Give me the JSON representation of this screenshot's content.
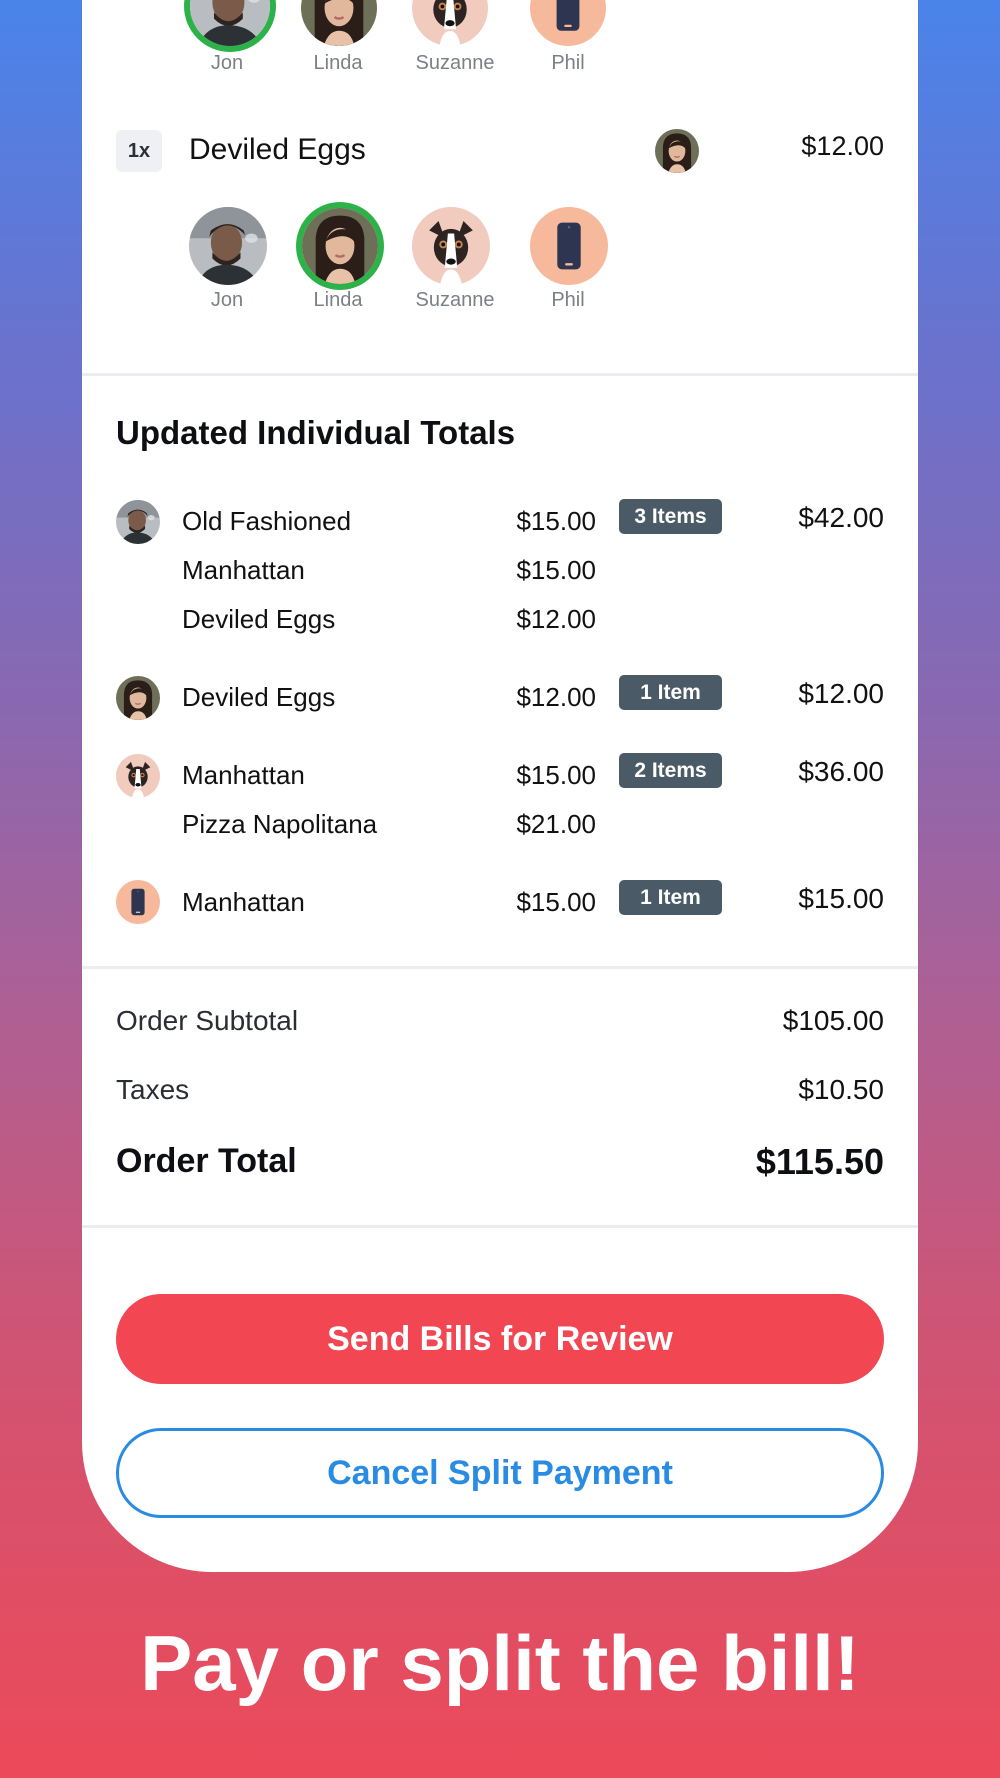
{
  "people": {
    "jon": "Jon",
    "linda": "Linda",
    "suzanne": "Suzanne",
    "phil": "Phil"
  },
  "item": {
    "qty": "1x",
    "name": "Deviled Eggs",
    "price": "$12.00"
  },
  "totals_section": {
    "title": "Updated Individual Totals",
    "groups": [
      {
        "items": [
          {
            "name": "Old Fashioned",
            "price": "$15.00"
          },
          {
            "name": "Manhattan",
            "price": "$15.00"
          },
          {
            "name": "Deviled Eggs",
            "price": "$12.00"
          }
        ],
        "badge": "3 Items",
        "total": "$42.00"
      },
      {
        "items": [
          {
            "name": "Deviled Eggs",
            "price": "$12.00"
          }
        ],
        "badge": "1 Item",
        "total": "$12.00"
      },
      {
        "items": [
          {
            "name": "Manhattan",
            "price": "$15.00"
          },
          {
            "name": "Pizza Napolitana",
            "price": "$21.00"
          }
        ],
        "badge": "2 Items",
        "total": "$36.00"
      },
      {
        "items": [
          {
            "name": "Manhattan",
            "price": "$15.00"
          }
        ],
        "badge": "1 Item",
        "total": "$15.00"
      }
    ]
  },
  "summary": {
    "subtotal_label": "Order Subtotal",
    "subtotal_value": "$105.00",
    "taxes_label": "Taxes",
    "taxes_value": "$10.50",
    "total_label": "Order Total",
    "total_value": "$115.50"
  },
  "actions": {
    "send_label": "Send Bills for Review",
    "cancel_label": "Cancel Split Payment"
  },
  "tagline": "Pay or split the bill!",
  "colors": {
    "accent_red": "#f24652",
    "accent_blue": "#2a8be2",
    "selected_ring": "#2db24a",
    "badge_bg": "#4a5a67"
  },
  "icons": {
    "jon": "man-photo-avatar",
    "linda": "woman-photo-avatar",
    "suzanne": "dog-photo-avatar",
    "phil": "phone-icon-avatar"
  }
}
